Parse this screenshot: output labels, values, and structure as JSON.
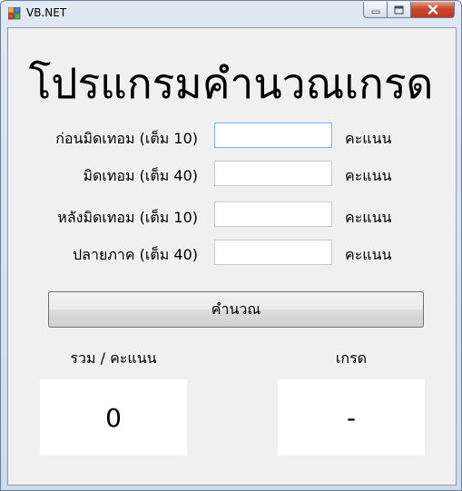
{
  "window": {
    "title": "VB.NET",
    "controls": {
      "minimize": "minimize",
      "maximize": "maximize",
      "close": "close"
    }
  },
  "heading": "โปรแกรมคำนวณเกรด",
  "fields": [
    {
      "label": "ก่อนมิดเทอม (เต็ม 10)",
      "value": "",
      "unit": "คะแนน"
    },
    {
      "label": "มิดเทอม (เต็ม 40)",
      "value": "",
      "unit": "คะแนน"
    },
    {
      "label": "หลังมิดเทอม (เต็ม 10)",
      "value": "",
      "unit": "คะแนน"
    },
    {
      "label": "ปลายภาค (เต็ม 40)",
      "value": "",
      "unit": "คะแนน"
    }
  ],
  "calculate_button": "คำนวณ",
  "results": {
    "total_label": "รวม / คะแนน",
    "total_value": "0",
    "grade_label": "เกรด",
    "grade_value": "-"
  },
  "colors": {
    "titlebar": "#cfdcec",
    "client": "#f0f0f0",
    "close_button": "#c9462b",
    "focus_border": "#7eb4ea"
  },
  "icons": [
    "app-icon",
    "minimize-icon",
    "maximize-icon",
    "close-icon"
  ]
}
